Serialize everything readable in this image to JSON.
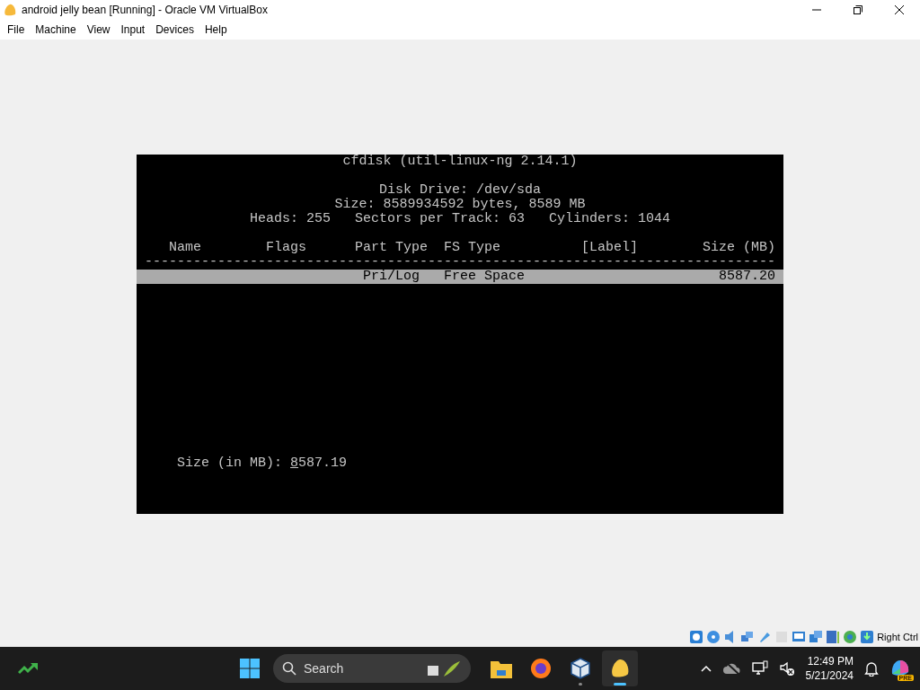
{
  "window": {
    "title": "android jelly bean [Running] - Oracle VM VirtualBox"
  },
  "menu": [
    "File",
    "Machine",
    "View",
    "Input",
    "Devices",
    "Help"
  ],
  "console": {
    "title": "cfdisk (util-linux-ng 2.14.1)",
    "info": [
      "Disk Drive: /dev/sda",
      "Size: 8589934592 bytes, 8589 MB",
      "Heads: 255   Sectors per Track: 63   Cylinders: 1044"
    ],
    "columns": [
      "Name",
      "Flags",
      "Part Type",
      "FS Type",
      "[Label]",
      "Size (MB)"
    ],
    "separator": "------------------------------------------------------------------------------",
    "rows": [
      {
        "part_type": "Pri/Log",
        "fs_type": "Free Space",
        "size": "8587.20",
        "selected": true
      }
    ],
    "prompt": {
      "label": "Size (in MB):",
      "value": "8587.19"
    }
  },
  "status_bar": {
    "host_key": "Right Ctrl"
  },
  "taskbar": {
    "search": {
      "placeholder": "Search"
    },
    "apps": [
      {
        "kind": "folder",
        "selected": false
      },
      {
        "kind": "browser",
        "selected": false
      },
      {
        "kind": "cube",
        "selected": false
      },
      {
        "kind": "vm",
        "selected": true
      }
    ],
    "tray": {
      "time": "12:49 PM",
      "date": "5/21/2024",
      "badge": "PRE"
    }
  }
}
